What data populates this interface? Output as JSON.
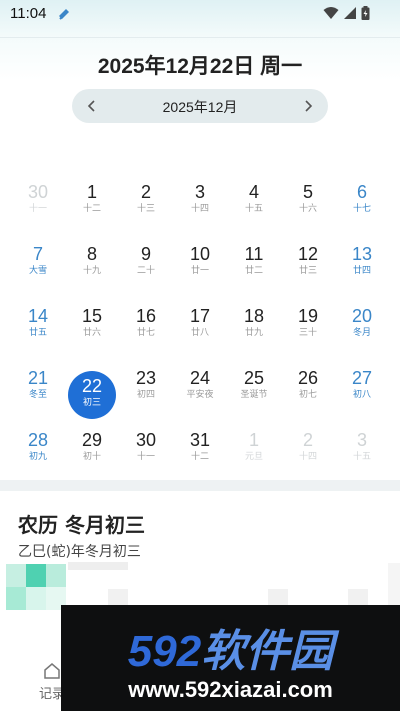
{
  "status_bar": {
    "time": "11:04"
  },
  "header": {
    "date_title": "2025年12月22日 周一",
    "month_label": "2025年12月"
  },
  "calendar": {
    "rows": [
      [
        {
          "day": "30",
          "lunar": "十一",
          "style": "muted"
        },
        {
          "day": "1",
          "lunar": "十二"
        },
        {
          "day": "2",
          "lunar": "十三"
        },
        {
          "day": "3",
          "lunar": "十四"
        },
        {
          "day": "4",
          "lunar": "十五"
        },
        {
          "day": "5",
          "lunar": "十六"
        },
        {
          "day": "6",
          "lunar": "十七",
          "style": "weekend"
        }
      ],
      [
        {
          "day": "7",
          "lunar": "大雪",
          "style": "weekend"
        },
        {
          "day": "8",
          "lunar": "十九"
        },
        {
          "day": "9",
          "lunar": "二十"
        },
        {
          "day": "10",
          "lunar": "廿一"
        },
        {
          "day": "11",
          "lunar": "廿二"
        },
        {
          "day": "12",
          "lunar": "廿三"
        },
        {
          "day": "13",
          "lunar": "廿四",
          "style": "weekend"
        }
      ],
      [
        {
          "day": "14",
          "lunar": "廿五",
          "style": "weekend"
        },
        {
          "day": "15",
          "lunar": "廿六"
        },
        {
          "day": "16",
          "lunar": "廿七"
        },
        {
          "day": "17",
          "lunar": "廿八"
        },
        {
          "day": "18",
          "lunar": "廿九"
        },
        {
          "day": "19",
          "lunar": "三十"
        },
        {
          "day": "20",
          "lunar": "冬月",
          "style": "weekend"
        }
      ],
      [
        {
          "day": "21",
          "lunar": "冬至",
          "style": "weekend"
        },
        {
          "day": "22",
          "lunar": "初三",
          "style": "selected"
        },
        {
          "day": "23",
          "lunar": "初四"
        },
        {
          "day": "24",
          "lunar": "平安夜"
        },
        {
          "day": "25",
          "lunar": "圣诞节"
        },
        {
          "day": "26",
          "lunar": "初七"
        },
        {
          "day": "27",
          "lunar": "初八",
          "style": "weekend"
        }
      ],
      [
        {
          "day": "28",
          "lunar": "初九",
          "style": "weekend"
        },
        {
          "day": "29",
          "lunar": "初十"
        },
        {
          "day": "30",
          "lunar": "十一"
        },
        {
          "day": "31",
          "lunar": "十二"
        },
        {
          "day": "1",
          "lunar": "元旦",
          "style": "muted"
        },
        {
          "day": "2",
          "lunar": "十四",
          "style": "muted"
        },
        {
          "day": "3",
          "lunar": "十五",
          "style": "muted"
        }
      ]
    ]
  },
  "lunar_card": {
    "title": "农历 冬月初三",
    "ganzhi": "乙巳(蛇)年冬月初三"
  },
  "bottom_nav": {
    "record_label": "记录"
  },
  "watermark": {
    "logo_number": "592",
    "logo_text": "软件园",
    "url": "www.592xiazai.com"
  },
  "colors": {
    "accent": "#1f6fd6",
    "weekend": "#3a86c8",
    "watermark_blue": "#2f69d8"
  }
}
